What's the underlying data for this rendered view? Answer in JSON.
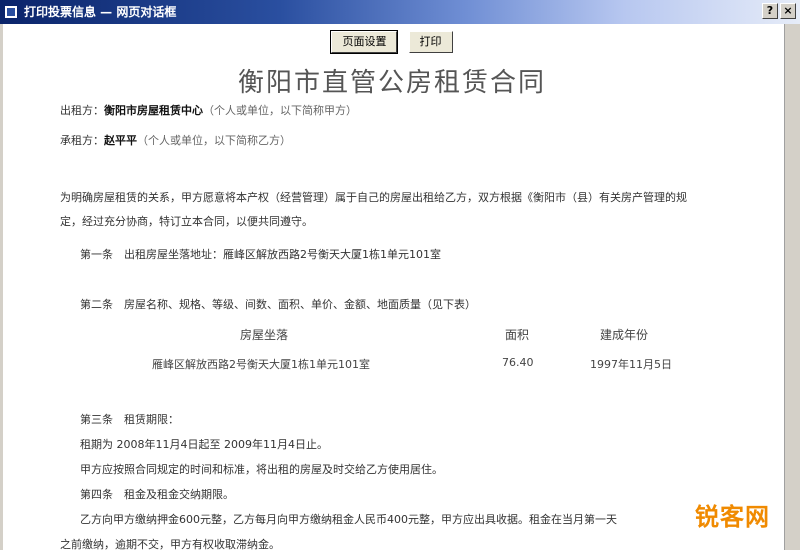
{
  "window": {
    "title": "打印投票信息 — 网页对话框",
    "controls": [
      "?",
      "×"
    ]
  },
  "toolbar": {
    "settings_label": "页面设置",
    "print_label": "打印"
  },
  "document": {
    "title": "衡阳市直管公房租赁合同",
    "party_a": {
      "label": "出租方：",
      "value": "衡阳市房屋租赁中心",
      "note": "（个人或单位，以下简称甲方）"
    },
    "party_b": {
      "label": "承租方：",
      "value": "赵平平",
      "note": "（个人或单位，以下简称乙方）"
    },
    "intro_1": "为明确房屋租赁的关系，甲方愿意将本产权（经营管理）属于自己的房屋出租给乙方，双方根据《衡阳市（县）有关房产管理的规定，经过充分协商，特订立本合同，以便共同遵守。",
    "article_1": "第一条　出租房屋坐落地址：雁峰区解放西路2号衡天大厦1栋1单元101室",
    "article_2": "第二条　房屋名称、规格、等级、间数、面积、单价、金额、地面质量（见下表）",
    "table": {
      "headers": [
        "房屋坐落",
        "面积",
        "建成年份"
      ],
      "row": [
        "雁峰区解放西路2号衡天大厦1栋1单元101室",
        "76.40",
        "1997年11月5日"
      ]
    },
    "article_3_title": "第三条　租赁期限：",
    "article_3_term": "租期为 2008年11月4日起至 2009年11月4日止。",
    "article_3_text": "甲方应按照合同规定的时间和标准，将出租的房屋及时交给乙方使用居住。",
    "article_4_title": "第四条　租金及租金交纳期限。",
    "article_4_text": "乙方向甲方缴纳押金600元整，乙方每月向甲方缴纳租金人民币400元整，甲方应出具收据。租金在当月第一天",
    "article_4_tail": "之前缴纳，逾期不交，甲方有权收取滞纳金。"
  },
  "watermark": "锐客网"
}
